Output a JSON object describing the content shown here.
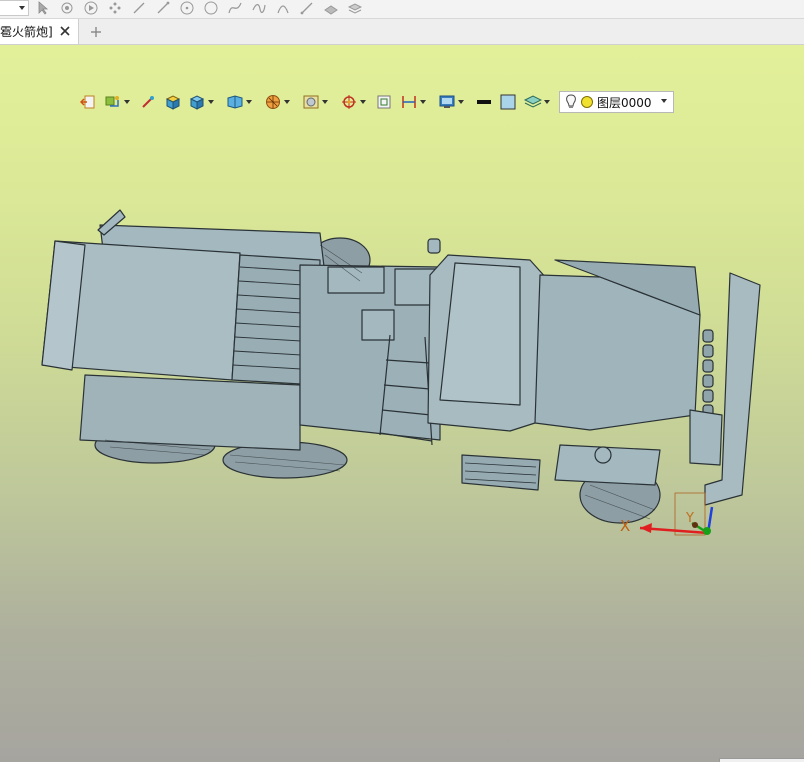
{
  "topbar": {
    "icons": [
      "select-arrow-icon",
      "filter-icon",
      "play-icon",
      "point-icon",
      "line-icon",
      "line2-icon",
      "circle-center-icon",
      "circle-icon",
      "curve-icon",
      "spline-icon",
      "arc-icon",
      "pen-icon",
      "surface-icon",
      "stack-icon"
    ]
  },
  "tabs": {
    "doc_title": "雹火箭炮]",
    "close_symbol": "✕",
    "new_tab_symbol": "+"
  },
  "view_toolbar": {
    "layer_value": "图层0000"
  },
  "axes": {
    "x_label": "X",
    "y_label": "Y"
  },
  "colors": {
    "model_fill": "#a3b8bf",
    "model_stroke": "#2a3236",
    "axis_x": "#e02020",
    "axis_y": "#18a018",
    "axis_z": "#2040e0"
  }
}
